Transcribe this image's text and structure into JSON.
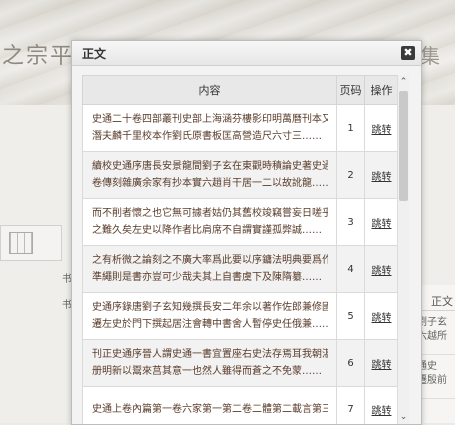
{
  "background": {
    "brand_left": "之宗平",
    "brand_right": "集",
    "side_char_1": "书",
    "side_char_2": "书",
    "right_header": "正文",
    "right_rows": [
      "劉子玄",
      "六越所",
      "通史",
      "遷殷前"
    ]
  },
  "dialog": {
    "title": "正文",
    "close_glyph": "✖",
    "columns": {
      "content": "内容",
      "page": "页码",
      "action": "操作"
    },
    "rows": [
      {
        "line1": "史通二十卷四部叢刊史部上海涵芬樓影印明萬曆刊本又據孫",
        "line2": "潛夫麟千里校本作劉氏原書板匡高營造尺六寸三……",
        "page": "1",
        "action": "跳转"
      },
      {
        "line1": "續校史通序唐長安景龍間劉子玄在東觀時積論史著史通二十",
        "line2": "卷傳刻雜廣余家有抄本實六趙肖干居一二以故訛龍……",
        "page": "2",
        "action": "跳转"
      },
      {
        "line1": "而不削者懷之也它無可據者姑仍其舊校竣竊嘗妄日嗟乎史職",
        "line2": "之難久矣左史以降作者比肩席不自謂實謹孤弊誠……",
        "page": "3",
        "action": "跳转"
      },
      {
        "line1": "之有析微之論刻之不廣大率爲此要以序鏞法明典要爲作史者",
        "line2": "準繩則是書亦豈可少哉夫其上自書虞下及陳隋纂……",
        "page": "4",
        "action": "跳转"
      },
      {
        "line1": "史通序錄唐劉子玄知幾撰長安二年余以著作佐郎兼修國史尋",
        "line2": "遷左史於門下撰起居注會轉中書舍人暫停史任俄兼……",
        "page": "5",
        "action": "跳转"
      },
      {
        "line1": "刊正史通序晉人謂史通一書宜置座右史法存焉耳我朝湛司板",
        "line2": "册明新以鬻來莒其意一也然人雖得而蒼之不免蒙……",
        "page": "6",
        "action": "跳转"
      },
      {
        "line1": "史通上卷內篇第一卷六家第一第二卷二體第二載言第三本紀",
        "line2": "",
        "page": "7",
        "action": "跳转"
      }
    ]
  },
  "scrollbar": {
    "up_glyph": "⌃",
    "down_glyph": "⌄"
  }
}
